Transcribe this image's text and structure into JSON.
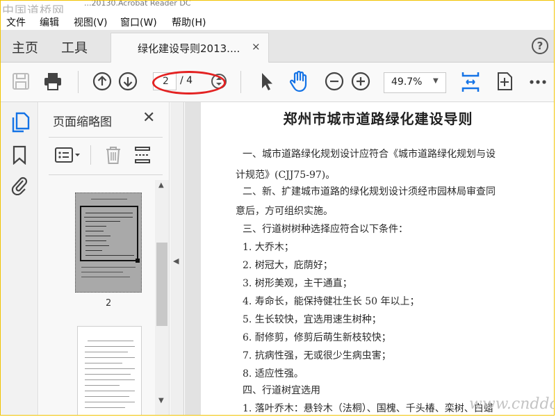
{
  "window": {
    "title_partial": "...20130.Acrobat Reader DC",
    "watermark": "中国道桥网"
  },
  "menu": [
    "文件",
    "编辑",
    "视图(V)",
    "窗口(W)",
    "帮助(H)"
  ],
  "tabs": {
    "home": "主页",
    "tools": "工具",
    "document": "绿化建设导则2013....",
    "close": "×",
    "help": "?"
  },
  "toolbar": {
    "current_page": "2",
    "total_pages": "/ 4",
    "zoom": "49.7%"
  },
  "panel": {
    "title": "页面缩略图",
    "close": "✕",
    "thumb_label": "2"
  },
  "document": {
    "title": "郑州市城市道路绿化建设导则",
    "lines": [
      "一、城市道路绿化规划设计应符合《城市道路绿化规划与设",
      "计规范》(CJJ75-97)。",
      "二、新、扩建城市道路的绿化规划设计须经市园林局审查同",
      "意后，方可组织实施。",
      "三、行道树树种选择应符合以下条件：",
      "1. 大乔木；",
      "2. 树冠大，庇荫好；",
      "3. 树形美观，主干通直；",
      "4. 寿命长，能保持健壮生长 50 年以上；",
      "5. 生长较快，宜选用速生树种；",
      "6. 耐修剪，修剪后萌生新枝较快；",
      "7. 抗病性强，无或很少生病虫害；",
      "8. 适应性强。",
      "四、行道树宜选用",
      "1. 落叶乔木：悬铃木（法桐）、国槐、千头椿、栾树、白蜡"
    ]
  },
  "site_watermark": "www.cnddo.com",
  "colors": {
    "accent": "#1473e6",
    "highlight": "#e32222",
    "frame": "#f2c400"
  }
}
